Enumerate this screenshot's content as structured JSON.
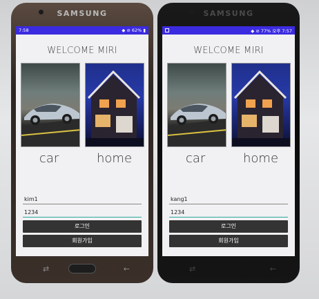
{
  "brand": "SAMSUNG",
  "phones": [
    {
      "status": {
        "time": "7:58",
        "battery": "62%"
      },
      "welcome": "WELCOME MIRI",
      "labels": {
        "car": "car",
        "home": "home"
      },
      "inputs": {
        "id": "kim1",
        "password": "1234"
      },
      "buttons": {
        "login": "로그인",
        "join": "회원가입"
      }
    },
    {
      "status": {
        "time": "7:57",
        "battery": "77% 오후"
      },
      "welcome": "WELCOME MIRI",
      "labels": {
        "car": "car",
        "home": "home"
      },
      "inputs": {
        "id": "kang1",
        "password": "1234"
      },
      "buttons": {
        "login": "로그인",
        "join": "회원가입"
      }
    }
  ]
}
